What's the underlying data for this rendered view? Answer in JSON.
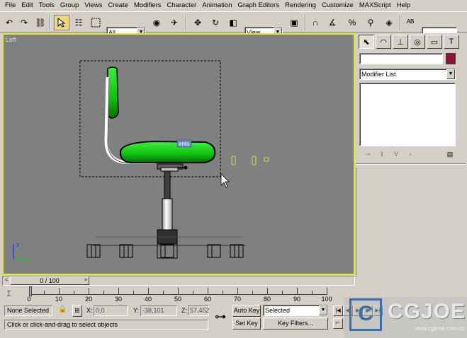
{
  "menu": [
    "File",
    "Edit",
    "Tools",
    "Group",
    "Views",
    "Create",
    "Modifiers",
    "Character",
    "Animation",
    "Graph Editors",
    "Rendering",
    "Customize",
    "MAXScript",
    "Help"
  ],
  "toolbar": {
    "selection_filter": "All",
    "reference_coord": "View"
  },
  "viewport": {
    "label": "Left",
    "object_label": "ento",
    "axis_labels": {
      "z": "z",
      "y": "y"
    }
  },
  "command_panel": {
    "modifier_list": "Modifier List"
  },
  "time_slider": {
    "position": "0 / 100",
    "prev": "<",
    "next": ">",
    "current_frame": 0,
    "total_frames": 100
  },
  "trackbar": {
    "tick_labels": [
      "0",
      "10",
      "20",
      "30",
      "40",
      "50",
      "60",
      "70",
      "80",
      "90",
      "100"
    ]
  },
  "status": {
    "selection": "None Selected",
    "prompt": "Click or click-and-drag to select objects",
    "x_label": "X:",
    "y_label": "Y:",
    "z_label": "Z:",
    "x_value": "0,0",
    "y_value": "-38,101",
    "z_value": "57,452",
    "auto_key": "Auto Key",
    "set_key": "Set Key",
    "key_mode": "Selected",
    "key_filters": "Key Filters..."
  },
  "watermark": {
    "logo": "C",
    "text": "CGJOE",
    "url": "www.cgtime.com.cn"
  }
}
